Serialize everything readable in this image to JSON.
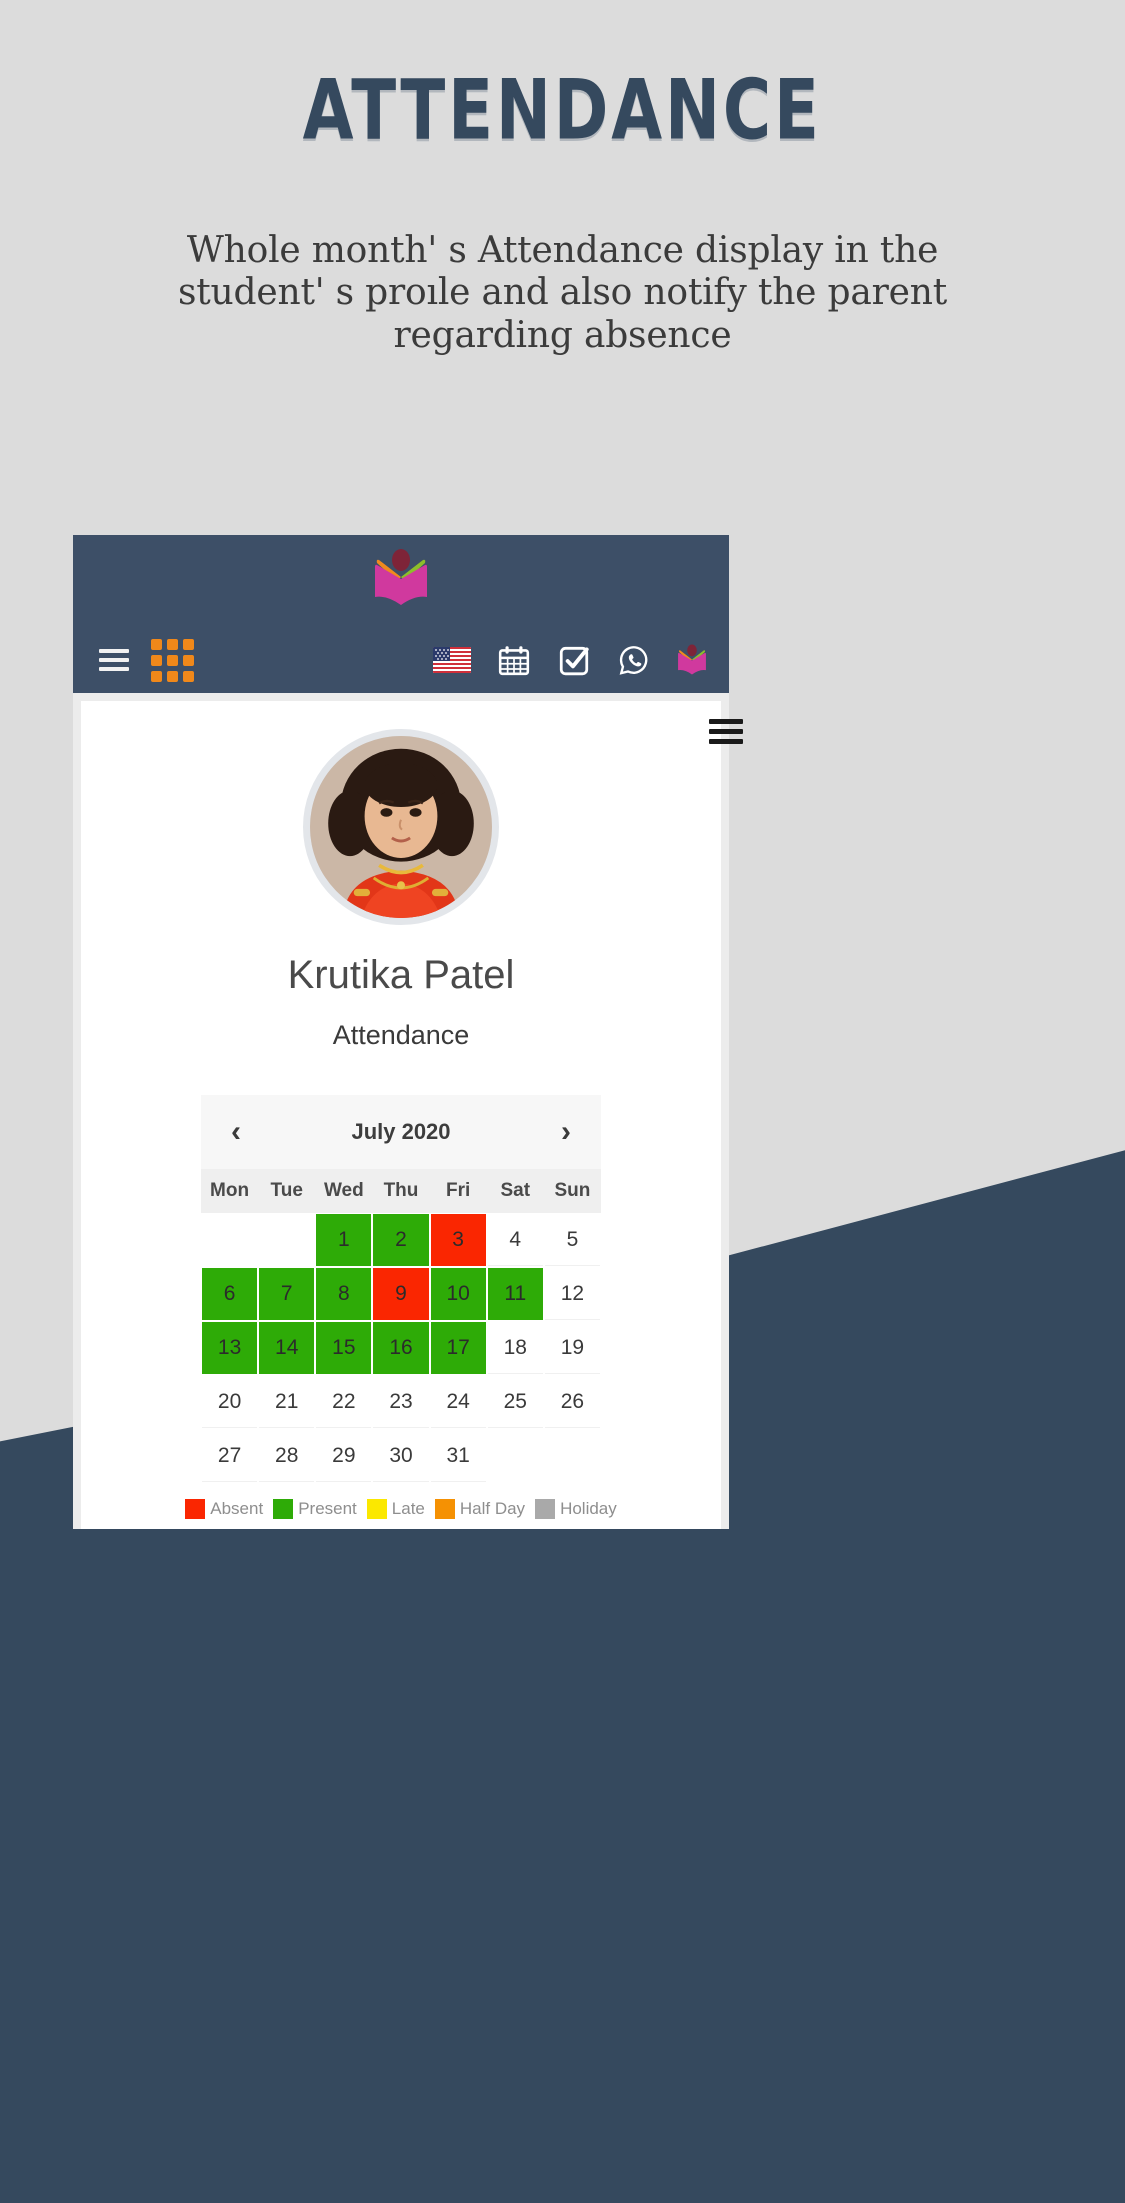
{
  "hero": {
    "title": "ATTENDANCE",
    "subtitle": "Whole month' s Attendance display in the student' s proıle and also notify the parent regarding absence",
    "title_color": "#35495e",
    "background_color": "#dcdcdc"
  },
  "app_header": {
    "background_color": "#3d4f67",
    "logo_name": "open-book-logo",
    "menu_icon": "hamburger-menu-icon",
    "apps_icon": "apps-grid-icon",
    "apps_icon_color": "#f0881a",
    "right_icons": [
      {
        "name": "us-flag-icon",
        "label": "United States flag"
      },
      {
        "name": "calendar-icon",
        "label": "Calendar"
      },
      {
        "name": "check-square-icon",
        "label": "Tasks"
      },
      {
        "name": "whatsapp-icon",
        "label": "WhatsApp"
      },
      {
        "name": "open-book-logo-icon",
        "label": "School logo"
      }
    ]
  },
  "panel": {
    "menu_icon": "panel-hamburger-icon",
    "student_name": "Krutika Patel",
    "section_title": "Attendance",
    "avatar_name": "student-avatar"
  },
  "calendar": {
    "month_label": "July 2020",
    "prev_label": "‹",
    "next_label": "›",
    "day_headers": [
      "Mon",
      "Tue",
      "Wed",
      "Thu",
      "Fri",
      "Sat",
      "Sun"
    ],
    "leading_blanks": 2,
    "days": [
      {
        "day": 1,
        "status": "present"
      },
      {
        "day": 2,
        "status": "present"
      },
      {
        "day": 3,
        "status": "absent"
      },
      {
        "day": 4,
        "status": "none"
      },
      {
        "day": 5,
        "status": "none"
      },
      {
        "day": 6,
        "status": "present"
      },
      {
        "day": 7,
        "status": "present"
      },
      {
        "day": 8,
        "status": "present"
      },
      {
        "day": 9,
        "status": "absent"
      },
      {
        "day": 10,
        "status": "present"
      },
      {
        "day": 11,
        "status": "present"
      },
      {
        "day": 12,
        "status": "none"
      },
      {
        "day": 13,
        "status": "present"
      },
      {
        "day": 14,
        "status": "present"
      },
      {
        "day": 15,
        "status": "present"
      },
      {
        "day": 16,
        "status": "present"
      },
      {
        "day": 17,
        "status": "present"
      },
      {
        "day": 18,
        "status": "none"
      },
      {
        "day": 19,
        "status": "none"
      },
      {
        "day": 20,
        "status": "none"
      },
      {
        "day": 21,
        "status": "none"
      },
      {
        "day": 22,
        "status": "none"
      },
      {
        "day": 23,
        "status": "none"
      },
      {
        "day": 24,
        "status": "none"
      },
      {
        "day": 25,
        "status": "none"
      },
      {
        "day": 26,
        "status": "none"
      },
      {
        "day": 27,
        "status": "none"
      },
      {
        "day": 28,
        "status": "none"
      },
      {
        "day": 29,
        "status": "none"
      },
      {
        "day": 30,
        "status": "none"
      },
      {
        "day": 31,
        "status": "none"
      }
    ],
    "status_colors": {
      "absent": "#fa2601",
      "present": "#2eab07",
      "late": "#fbe800",
      "halfday": "#f59103",
      "holiday": "#a9a9a9",
      "none": "transparent"
    },
    "legend": [
      {
        "label": "Absent",
        "key": "absent"
      },
      {
        "label": "Present",
        "key": "present"
      },
      {
        "label": "Late",
        "key": "late"
      },
      {
        "label": "Half Day",
        "key": "halfday"
      },
      {
        "label": "Holiday",
        "key": "holiday"
      }
    ]
  }
}
